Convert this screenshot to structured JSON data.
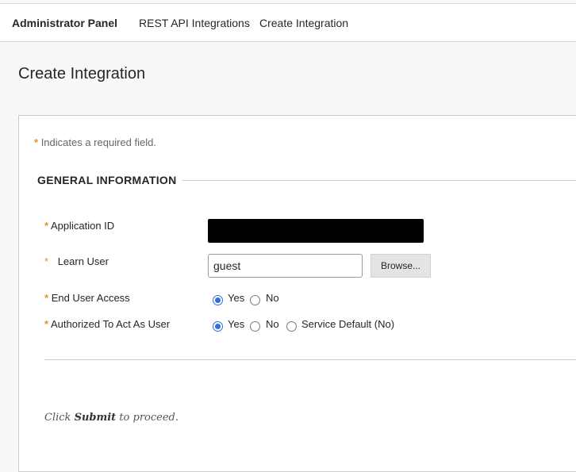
{
  "breadcrumb": {
    "items": [
      {
        "label": "Administrator Panel"
      },
      {
        "label": "REST API Integrations"
      },
      {
        "label": "Create Integration"
      }
    ]
  },
  "page": {
    "title": "Create Integration"
  },
  "form": {
    "required_star": "*",
    "required_note": "Indicates a required field.",
    "section_title": "GENERAL INFORMATION",
    "fields": {
      "application_id": {
        "label": "Application ID"
      },
      "learn_user": {
        "label": "Learn User",
        "value": "guest",
        "browse_label": "Browse..."
      },
      "end_user_access": {
        "label": "End User Access",
        "options": [
          {
            "label": "Yes",
            "selected": true
          },
          {
            "label": "No",
            "selected": false
          }
        ]
      },
      "act_as_user": {
        "label": "Authorized To Act As User",
        "options": [
          {
            "label": "Yes",
            "selected": true
          },
          {
            "label": "No",
            "selected": false
          },
          {
            "label": "Service Default (No)",
            "selected": false
          }
        ]
      }
    },
    "submit_hint": {
      "before": "Click ",
      "action": "Submit",
      "after": " to proceed."
    }
  },
  "colors": {
    "required_star": "#e38e2c",
    "radio_selected": "#2f6fd6"
  }
}
